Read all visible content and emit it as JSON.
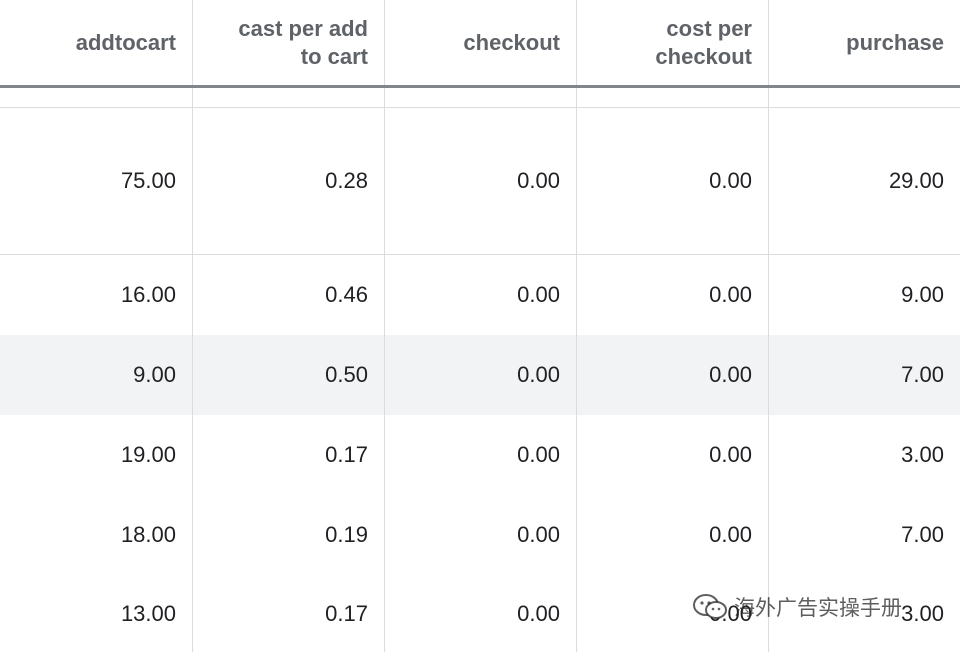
{
  "columns": [
    {
      "label": "addtocart"
    },
    {
      "label": "cast per add\nto cart"
    },
    {
      "label": "checkout"
    },
    {
      "label": "cost per\ncheckout"
    },
    {
      "label": "purchase"
    }
  ],
  "rows": [
    [
      "75.00",
      "0.28",
      "0.00",
      "0.00",
      "29.00"
    ],
    [
      "16.00",
      "0.46",
      "0.00",
      "0.00",
      "9.00"
    ],
    [
      "9.00",
      "0.50",
      "0.00",
      "0.00",
      "7.00"
    ],
    [
      "19.00",
      "0.17",
      "0.00",
      "0.00",
      "3.00"
    ],
    [
      "18.00",
      "0.19",
      "0.00",
      "0.00",
      "7.00"
    ],
    [
      "13.00",
      "0.17",
      "0.00",
      "0.00",
      "3.00"
    ]
  ],
  "watermark": {
    "text": "海外广告实操手册",
    "icon": "wechat-icon"
  },
  "colors": {
    "header_text": "#5f6368",
    "cell_text": "#202124",
    "grid": "#dadce0",
    "header_rule": "#80868b",
    "highlight_row": "#f1f3f4"
  }
}
